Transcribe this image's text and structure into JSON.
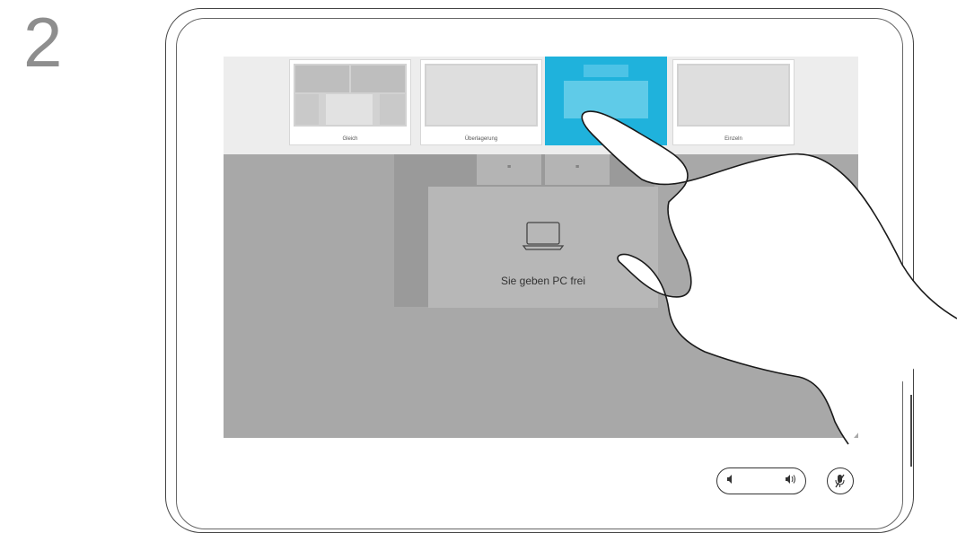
{
  "step": {
    "number": "2"
  },
  "layout_bar": {
    "options": [
      {
        "label": "Gleich",
        "selected": false
      },
      {
        "label": "Überlagerung",
        "selected": false
      },
      {
        "label": "",
        "selected": true
      },
      {
        "label": "Einzeln",
        "selected": false
      }
    ]
  },
  "camera_tiles": [
    "≡",
    "≡"
  ],
  "share": {
    "label": "Sie geben PC frei",
    "icon": "laptop-icon"
  },
  "controls": {
    "volume_down_icon": "speaker-low-icon",
    "volume_up_icon": "speaker-high-icon",
    "mute_icon": "microphone-muted-icon"
  },
  "colors": {
    "accent": "#1fb2dc",
    "screen_bg": "#a8a8a8",
    "bar_bg": "#ededed"
  }
}
